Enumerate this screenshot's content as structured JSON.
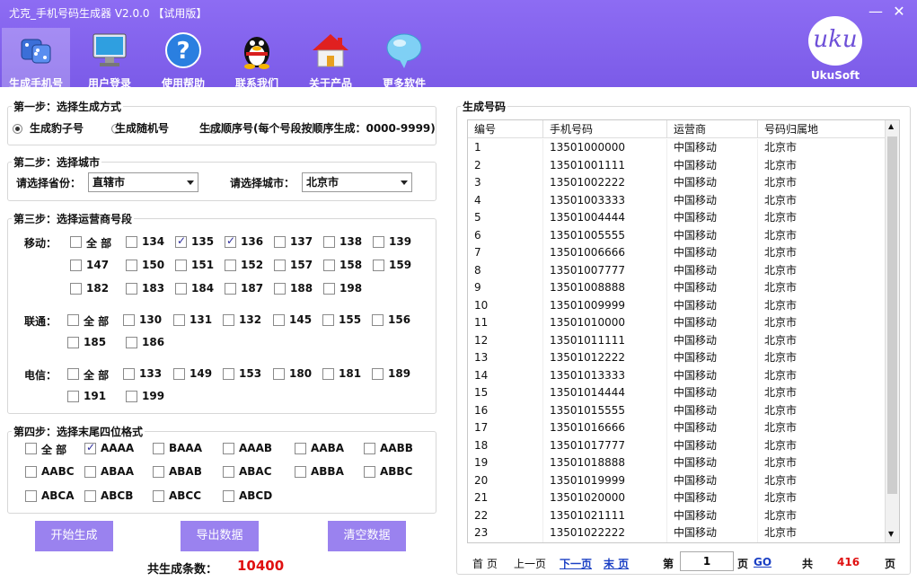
{
  "window": {
    "title": "尤克_手机号码生成器 V2.0.0 【试用版】",
    "minimize": "—",
    "close": "✕"
  },
  "toolbar": [
    {
      "label": "生成手机号",
      "icon": "dice-icon"
    },
    {
      "label": "用户登录",
      "icon": "monitor-icon"
    },
    {
      "label": "使用帮助",
      "icon": "help-icon"
    },
    {
      "label": "联系我们",
      "icon": "penguin-icon"
    },
    {
      "label": "关于产品",
      "icon": "house-icon"
    },
    {
      "label": "更多软件",
      "icon": "chat-bubble-icon"
    }
  ],
  "logo": {
    "mark": "uku",
    "text": "UkuSoft"
  },
  "step1": {
    "legend": "第一步：选择生成方式",
    "options": [
      "生成豹子号",
      "生成随机号",
      "生成顺序号(每个号段按顺序生成：0000-9999)"
    ],
    "selected": 0
  },
  "step2": {
    "legend": "第二步：选择城市",
    "province_label": "请选择省份：",
    "province": "直辖市",
    "city_label": "请选择城市：",
    "city": "北京市"
  },
  "step3": {
    "legend": "第三步：选择运营商号段",
    "mobile": {
      "label": "移动：",
      "all": "全 部",
      "codes": [
        "134",
        "135",
        "136",
        "137",
        "138",
        "139",
        "147",
        "150",
        "151",
        "152",
        "157",
        "158",
        "159",
        "182",
        "183",
        "184",
        "187",
        "188",
        "198"
      ],
      "checked": [
        "135",
        "136"
      ]
    },
    "unicom": {
      "label": "联通：",
      "all": "全 部",
      "codes": [
        "130",
        "131",
        "132",
        "145",
        "155",
        "156",
        "185",
        "186"
      ],
      "checked": []
    },
    "telecom": {
      "label": "电信：",
      "all": "全 部",
      "codes": [
        "133",
        "149",
        "153",
        "180",
        "181",
        "189",
        "191",
        "199"
      ],
      "checked": []
    }
  },
  "step4": {
    "legend": "第四步：选择末尾四位格式",
    "formats": [
      "全 部",
      "AAAA",
      "BAAA",
      "AAAB",
      "AABA",
      "AABB",
      "AABC",
      "ABAA",
      "ABAB",
      "ABAC",
      "ABBA",
      "ABBC",
      "ABCA",
      "ABCB",
      "ABCC",
      "ABCD"
    ],
    "checked": [
      "AAAA"
    ]
  },
  "buttons": {
    "start": "开始生成",
    "export": "导出数据",
    "clear": "清空数据"
  },
  "total": {
    "label": "共生成条数：",
    "value": "10400",
    "color": "#e01010"
  },
  "results": {
    "legend": "生成号码",
    "columns": [
      "编号",
      "手机号码",
      "运营商",
      "号码归属地"
    ],
    "rows": [
      [
        "1",
        "13501000000",
        "中国移动",
        "北京市"
      ],
      [
        "2",
        "13501001111",
        "中国移动",
        "北京市"
      ],
      [
        "3",
        "13501002222",
        "中国移动",
        "北京市"
      ],
      [
        "4",
        "13501003333",
        "中国移动",
        "北京市"
      ],
      [
        "5",
        "13501004444",
        "中国移动",
        "北京市"
      ],
      [
        "6",
        "13501005555",
        "中国移动",
        "北京市"
      ],
      [
        "7",
        "13501006666",
        "中国移动",
        "北京市"
      ],
      [
        "8",
        "13501007777",
        "中国移动",
        "北京市"
      ],
      [
        "9",
        "13501008888",
        "中国移动",
        "北京市"
      ],
      [
        "10",
        "13501009999",
        "中国移动",
        "北京市"
      ],
      [
        "11",
        "13501010000",
        "中国移动",
        "北京市"
      ],
      [
        "12",
        "13501011111",
        "中国移动",
        "北京市"
      ],
      [
        "13",
        "13501012222",
        "中国移动",
        "北京市"
      ],
      [
        "14",
        "13501013333",
        "中国移动",
        "北京市"
      ],
      [
        "15",
        "13501014444",
        "中国移动",
        "北京市"
      ],
      [
        "16",
        "13501015555",
        "中国移动",
        "北京市"
      ],
      [
        "17",
        "13501016666",
        "中国移动",
        "北京市"
      ],
      [
        "18",
        "13501017777",
        "中国移动",
        "北京市"
      ],
      [
        "19",
        "13501018888",
        "中国移动",
        "北京市"
      ],
      [
        "20",
        "13501019999",
        "中国移动",
        "北京市"
      ],
      [
        "21",
        "13501020000",
        "中国移动",
        "北京市"
      ],
      [
        "22",
        "13501021111",
        "中国移动",
        "北京市"
      ],
      [
        "23",
        "13501022222",
        "中国移动",
        "北京市"
      ]
    ]
  },
  "pager": {
    "first": "首 页",
    "prev": "上一页",
    "next": "下一页",
    "last": "末 页",
    "page_label": "第",
    "page": "1",
    "page_suffix": "页",
    "go": "GO",
    "total_label": "共",
    "total_pages": "416",
    "total_suffix": "页"
  },
  "colors": {
    "accent": "#7b5be8",
    "button": "#9a82ef",
    "link": "#1a3fc4",
    "count": "#e01010"
  }
}
